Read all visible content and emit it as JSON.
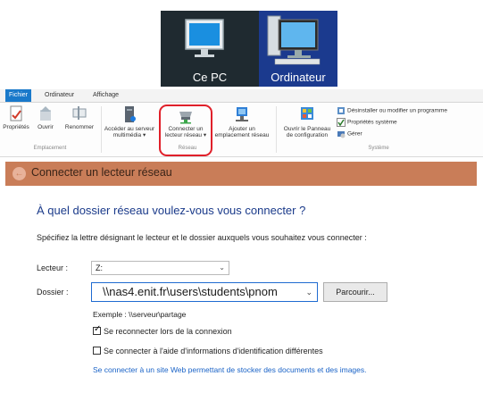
{
  "tiles": {
    "this_pc": "Ce PC",
    "computer": "Ordinateur"
  },
  "ribbon": {
    "tabs": [
      "Fichier",
      "Ordinateur",
      "Affichage"
    ],
    "groups": {
      "location": {
        "label": "Emplacement",
        "buttons": [
          "Propriétés",
          "Ouvrir",
          "Renommer"
        ]
      },
      "network": {
        "label": "Réseau",
        "media_line1": "Accéder au serveur",
        "media_line2": "multimédia ▾",
        "map_line1": "Connecter un",
        "map_line2": "lecteur réseau ▾",
        "add_line1": "Ajouter un",
        "add_line2": "emplacement réseau"
      },
      "system": {
        "label": "Système",
        "cp_line1": "Ouvrir le Panneau",
        "cp_line2": "de configuration",
        "uninstall": "Désinstaller ou modifier un programme",
        "sys_props": "Propriétés système",
        "manage": "Gérer"
      }
    }
  },
  "wizard": {
    "title": "Connecter un lecteur réseau",
    "heading": "À quel dossier réseau voulez-vous vous connecter ?",
    "description": "Spécifiez la lettre désignant le lecteur et le dossier auxquels vous souhaitez vous connecter :",
    "drive_label": "Lecteur :",
    "drive_value": "Z:",
    "folder_label": "Dossier :",
    "folder_value": "\\\\nas4.enit.fr\\users\\students\\pnom",
    "browse_label": "Parcourir...",
    "example": "Exemple : \\\\serveur\\partage",
    "reconnect_label": "Se reconnecter lors de la connexion",
    "reconnect_checked": true,
    "other_creds_label": "Se connecter à l'aide d'informations d'identification différentes",
    "other_creds_checked": false,
    "website_link": "Se connecter à un site Web permettant de stocker des documents et des images."
  },
  "colors": {
    "header": "#c97d58",
    "highlight": "#e0202a",
    "link": "#1a63c7",
    "active_tab": "#1979ca"
  }
}
